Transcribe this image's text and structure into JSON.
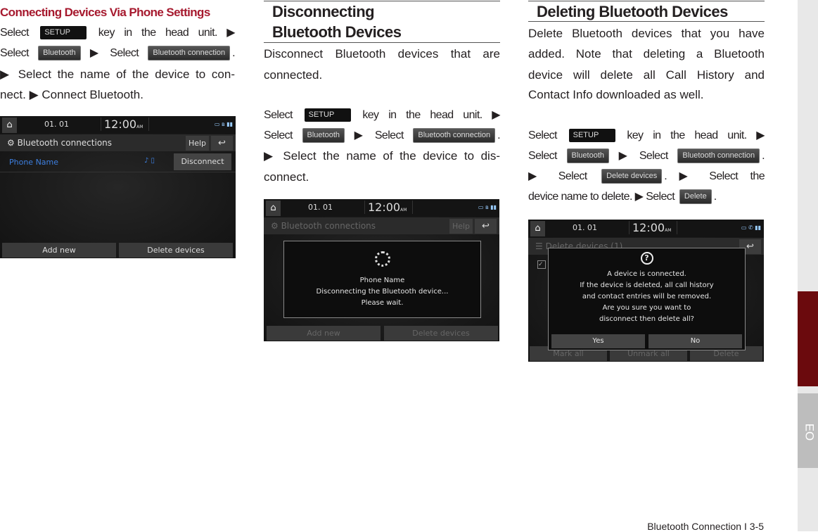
{
  "col1": {
    "heading": "Connecting Devices Via Phone Settings",
    "lines": [
      [
        {
          "t": "Select "
        },
        {
          "k": "SETUP",
          "c": "setup"
        },
        {
          "t": " key in the head unit. ▶"
        }
      ],
      [
        {
          "t": "Select "
        },
        {
          "k": "Bluetooth",
          "c": "btn"
        },
        {
          "t": " ▶ Select "
        },
        {
          "k": "Bluetooth connection",
          "c": "btn"
        },
        {
          "t": "."
        }
      ],
      [
        {
          "t": "▶ Select the name of the device to con-"
        }
      ],
      [
        {
          "t": "nect. ▶ Connect Bluetooth."
        }
      ]
    ]
  },
  "col2": {
    "heading_lines": [
      "Disconnecting",
      "Bluetooth Devices"
    ],
    "lines": [
      [
        {
          "t": "Disconnect Bluetooth devices that are"
        }
      ],
      [
        {
          "t": "connected."
        }
      ],
      [
        {
          "t": "Select "
        },
        {
          "k": "SETUP",
          "c": "setup"
        },
        {
          "t": " key in the head unit. ▶"
        }
      ],
      [
        {
          "t": "Select "
        },
        {
          "k": "Bluetooth",
          "c": "btn"
        },
        {
          "t": " ▶ Select "
        },
        {
          "k": "Bluetooth connection",
          "c": "btn"
        },
        {
          "t": "."
        }
      ],
      [
        {
          "t": "▶ Select the name of the device to dis-"
        }
      ],
      [
        {
          "t": "connect."
        }
      ]
    ]
  },
  "col3": {
    "heading": "Deleting Bluetooth Devices",
    "lines": [
      [
        {
          "t": "Delete Bluetooth devices that you have"
        }
      ],
      [
        {
          "t": "added. Note that deleting a Bluetooth"
        }
      ],
      [
        {
          "t": "device will delete all Call History and"
        }
      ],
      [
        {
          "t": "Contact Info downloaded as well."
        }
      ],
      [
        {
          "t": "Select "
        },
        {
          "k": "SETUP",
          "c": "setup"
        },
        {
          "t": " key in the head unit. ▶"
        }
      ],
      [
        {
          "t": "Select "
        },
        {
          "k": "Bluetooth",
          "c": "btn"
        },
        {
          "t": " ▶ Select "
        },
        {
          "k": "Bluetooth connection",
          "c": "btn"
        },
        {
          "t": "."
        }
      ],
      [
        {
          "t": "▶ Select "
        },
        {
          "k": "Delete devices",
          "c": "btn"
        },
        {
          "t": ". ▶ Select the"
        }
      ],
      [
        {
          "t": "device name to delete. ▶ Select "
        },
        {
          "k": "Delete",
          "c": "btn"
        },
        {
          "t": "."
        }
      ]
    ]
  },
  "screen": {
    "home_icon": "home-icon",
    "date": "01. 01",
    "time": "12:00",
    "ampm": "AM",
    "title": "Bluetooth connections",
    "help": "Help",
    "back_icon": "back-arrow-icon",
    "phone_name": "Phone Name",
    "disconnect": "Disconnect",
    "add_new": "Add new",
    "delete_devices": "Delete devices"
  },
  "screen2": {
    "dialog": [
      "Phone Name",
      "Disconnecting the Bluetooth device...",
      "Please wait."
    ]
  },
  "screen3": {
    "title": "Delete devices (1)",
    "dialog": [
      "A device is connected.",
      "If the device is deleted, all call history",
      "and contact entries will be removed.",
      "Are you sure you want to",
      "disconnect then delete all?"
    ],
    "yes": "Yes",
    "no": "No",
    "mark_all": "Mark all",
    "unmark_all": "Unmark all",
    "delete": "Delete"
  },
  "side_tab": "EO",
  "footer": "Bluetooth Connection I 3-5",
  "colors": {
    "heading_red": "#a6192e",
    "tab_red": "#6b0a0d",
    "link_blue": "#3d7fe0"
  }
}
